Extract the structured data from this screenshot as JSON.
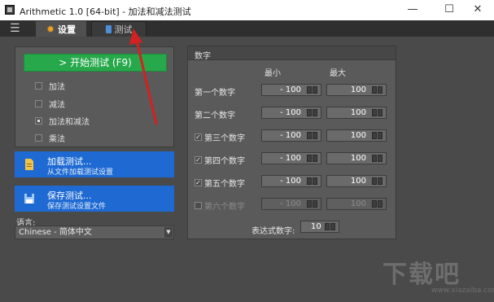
{
  "window": {
    "title": "Arithmetic 1.0  [64-bit] - 加法和减法测试",
    "minimize": "—",
    "maximize": "☐",
    "close": "✕"
  },
  "tabs": [
    {
      "label": "设置",
      "icon": "gear-icon",
      "active": true
    },
    {
      "label": "测试",
      "icon": "calculator-icon",
      "active": false
    }
  ],
  "menu_icon": "☰",
  "left": {
    "start_button": "> 开始测试 (F9)",
    "operations": [
      {
        "label": "加法",
        "checked": false
      },
      {
        "label": "减法",
        "checked": false
      },
      {
        "label": "加法和减法",
        "checked": true
      },
      {
        "label": "乘法",
        "checked": false
      }
    ],
    "load": {
      "title": "加载测试...",
      "subtitle": "从文件加载测试设置"
    },
    "save": {
      "title": "保存测试...",
      "subtitle": "保存测试设置文件"
    },
    "language_label": "语言:",
    "language_value": "Chinese - 简体中文"
  },
  "numbers": {
    "title": "数字",
    "col_min": "最小",
    "col_max": "最大",
    "rows": [
      {
        "label": "第一个数字",
        "checkbox": false,
        "checked": false,
        "enabled": true,
        "min": "- 100",
        "max": "100"
      },
      {
        "label": "第二个数字",
        "checkbox": false,
        "checked": false,
        "enabled": true,
        "min": "- 100",
        "max": "100"
      },
      {
        "label": "第三个数字",
        "checkbox": true,
        "checked": true,
        "enabled": true,
        "min": "- 100",
        "max": "100"
      },
      {
        "label": "第四个数字",
        "checkbox": true,
        "checked": true,
        "enabled": true,
        "min": "- 100",
        "max": "100"
      },
      {
        "label": "第五个数字",
        "checkbox": true,
        "checked": true,
        "enabled": true,
        "min": "- 100",
        "max": "100"
      },
      {
        "label": "第六个数字",
        "checkbox": true,
        "checked": false,
        "enabled": false,
        "min": "- 100",
        "max": "100"
      }
    ],
    "expression_label": "表达式数字:",
    "expression_value": "10"
  },
  "watermark": {
    "main": "下载吧",
    "sub": "www.xiazaiba.com"
  },
  "colors": {
    "accent_green": "#27a84b",
    "accent_blue": "#1e6ad2",
    "annotation_red": "#d42020"
  }
}
